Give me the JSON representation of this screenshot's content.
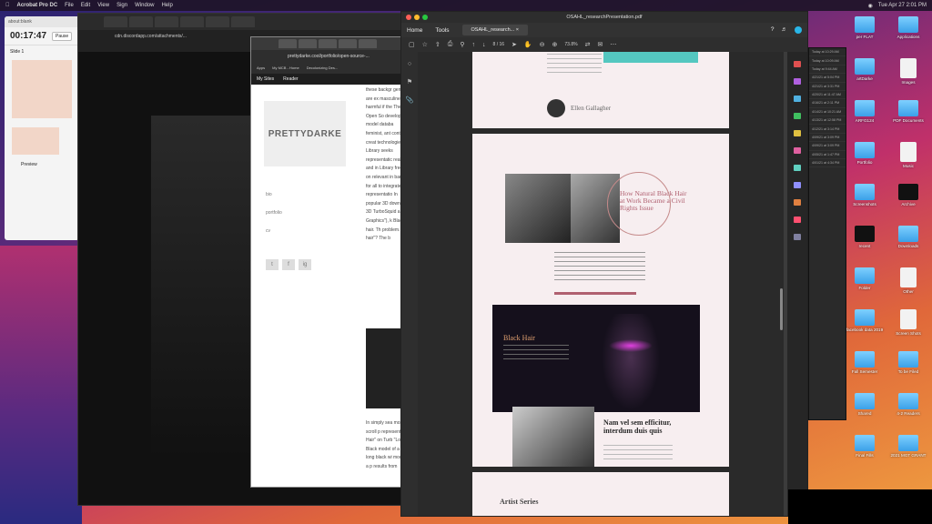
{
  "menubar": {
    "app_name": "Acrobat Pro DC",
    "items": [
      "File",
      "Edit",
      "View",
      "Sign",
      "Window",
      "Help"
    ],
    "clock": "Tue Apr 27  2:01 PM"
  },
  "timer": {
    "title": "about:blank",
    "time": "00:17:47",
    "pause_label": "Pause",
    "slide_label": "Slide 1",
    "thumb_caption": "Preview"
  },
  "browser_back": {
    "url": "cdn.discordapp.com/attachments/..."
  },
  "browser_mid": {
    "url": "prettydarke.cool/portfolio/open-source-...",
    "bookmarks": [
      "Apps",
      "My MCB - Home",
      "Decolonizing Des..."
    ],
    "wp_bar": [
      "My Sites",
      "Reader"
    ],
    "logo": "PRETTYDARKE",
    "nav": [
      "bio",
      "portfolio",
      "cv"
    ],
    "social": [
      "t",
      "f",
      "ig"
    ],
    "article_text": "these backgr gender, are ex masculine, ins harmful if the The Open So developed model databa feminist, ant content creat technologies Library seeks representatic reality, and in Library free a on relevant in barrier for all to integrate a representatio In popular 3D download 3D TurboSquid a Graphics\"), k Black hair. Th problem. I se hair\"? The b",
    "article_text2": "In simply sea most scroll p representatio Hair\" on Turb \"Long Black model of a wh long black wi model of a p results from"
  },
  "acrobat": {
    "doc_title": "OSAHL_researchPresentation.pdf",
    "menu_home": "Home",
    "menu_tools": "Tools",
    "doc_tab": "OSAHL_research...",
    "page_indicator": "8 / 16",
    "zoom": "73.8%",
    "pages": {
      "author": "Ellen Gallagher",
      "headline": "How Natural Black Hair at Work Became a Civil Rights Issue",
      "section_title": "Black Hair",
      "subhead": "Nam vel sem efficitur, interdum duis quis",
      "next_section": "Artist Series"
    },
    "right_panel_colors": [
      "#e05050",
      "#b060e0",
      "#50b0e0",
      "#40c060",
      "#e0c040",
      "#e060a0",
      "#60d0c0",
      "#9090ff",
      "#e08040",
      "#ff5070",
      "#8080a0"
    ]
  },
  "finder_rows": [
    "Today at 10:29 AM",
    "Today at 10:09 AM",
    "Today at 9:44 AM",
    "4/21/21 at 5:04 PM",
    "4/21/21 at 3:31 PM",
    "4/20/21 at 11:47 AM",
    "4/16/21 at 2:11 PM",
    "4/14/21 at 10:21 AM",
    "4/13/21 at 12:58 PM",
    "4/12/21 at 3:14 PM",
    "4/09/21 at 3:09 PM",
    "4/09/21 at 3:09 PM",
    "4/05/21 at 1:47 PM",
    "4/01/21 at 4:34 PM"
  ],
  "desktop_icons": [
    {
      "label": "per FLAT",
      "kind": "folder"
    },
    {
      "label": "Applications",
      "kind": "folder"
    },
    {
      "label": "artDarke",
      "kind": "folder"
    },
    {
      "label": "Images",
      "kind": "doc"
    },
    {
      "label": "ARFG124",
      "kind": "folder"
    },
    {
      "label": "PDF Documents",
      "kind": "folder"
    },
    {
      "label": "Portfolio",
      "kind": "folder"
    },
    {
      "label": "Music",
      "kind": "doc"
    },
    {
      "label": "Screenshots",
      "kind": "folder"
    },
    {
      "label": "Archive",
      "kind": "dark"
    },
    {
      "label": "recent",
      "kind": "dark"
    },
    {
      "label": "Downloads",
      "kind": "folder"
    },
    {
      "label": "Folder",
      "kind": "folder"
    },
    {
      "label": "Other",
      "kind": "doc"
    },
    {
      "label": "facebook data 2019",
      "kind": "folder"
    },
    {
      "label": "Screen Shots",
      "kind": "doc"
    },
    {
      "label": "Fall Semester",
      "kind": "folder"
    },
    {
      "label": "To be Filed",
      "kind": "folder"
    },
    {
      "label": "Shared",
      "kind": "folder"
    },
    {
      "label": "4-2 Readers",
      "kind": "folder"
    },
    {
      "label": "Final Fills",
      "kind": "folder"
    },
    {
      "label": "2021 MGT GRANT",
      "kind": "folder"
    }
  ]
}
